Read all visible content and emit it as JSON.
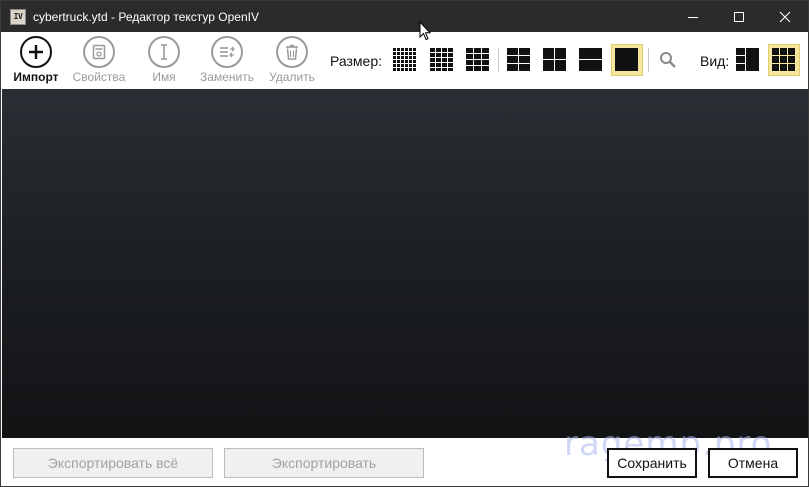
{
  "window": {
    "app_icon_text": "IV",
    "title": "cybertruck.ytd - Редактор текстур OpenIV"
  },
  "toolbar": {
    "import_label": "Импорт",
    "properties_label": "Свойства",
    "name_label": "Имя",
    "replace_label": "Заменить",
    "delete_label": "Удалить",
    "size_label": "Размер:",
    "view_label": "Вид:"
  },
  "footer": {
    "export_all_label": "Экспортировать всё",
    "export_label": "Экспортировать",
    "save_label": "Сохранить",
    "cancel_label": "Отмена",
    "watermark": "ragemp.pro"
  },
  "colors": {
    "selection_highlight": "#f6e6a0",
    "titlebar": "#2b2b2b"
  }
}
